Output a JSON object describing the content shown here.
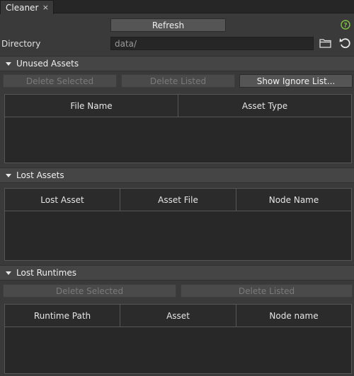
{
  "tab": {
    "title": "Cleaner",
    "close_glyph": "×"
  },
  "toolbar": {
    "refresh_label": "Refresh",
    "help_icon": "help-circle-icon"
  },
  "directory": {
    "label": "Directory",
    "value": "data/",
    "browse_icon": "folder-icon",
    "reset_icon": "undo-icon"
  },
  "unused_assets": {
    "title": "Unused Assets",
    "delete_selected_label": "Delete Selected",
    "delete_listed_label": "Delete Listed",
    "show_ignore_label": "Show Ignore List...",
    "columns": [
      "File Name",
      "Asset Type"
    ]
  },
  "lost_assets": {
    "title": "Lost Assets",
    "columns": [
      "Lost Asset",
      "Asset File",
      "Node Name"
    ]
  },
  "lost_runtimes": {
    "title": "Lost Runtimes",
    "delete_selected_label": "Delete Selected",
    "delete_listed_label": "Delete Listed",
    "columns": [
      "Runtime Path",
      "Asset",
      "Node name"
    ]
  },
  "colors": {
    "background": "#3a3a3a",
    "button": "#555555",
    "table_bg": "#282828",
    "help_green": "#7fc241"
  }
}
